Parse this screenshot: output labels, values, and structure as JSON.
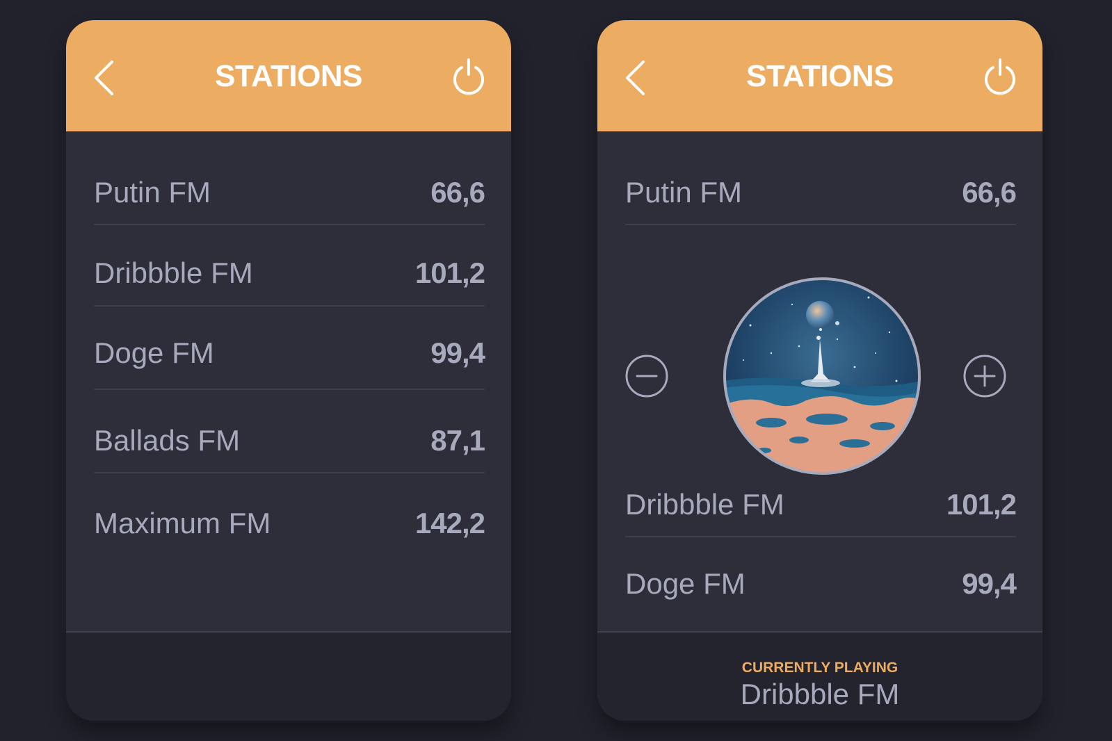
{
  "colors": {
    "background": "#21222c",
    "panel": "#2d2e3a",
    "header_accent": "#ecac62",
    "text": "#a7aabd",
    "divider": "#3e3f4d"
  },
  "left_screen": {
    "header": {
      "title": "STATIONS",
      "back_icon": "chevron-left-icon",
      "power_icon": "power-icon"
    },
    "stations": [
      {
        "name": "Putin FM",
        "frequency": "66,6"
      },
      {
        "name": "Dribbble FM",
        "frequency": "101,2"
      },
      {
        "name": "Doge FM",
        "frequency": "99,4"
      },
      {
        "name": "Ballads FM",
        "frequency": "87,1"
      },
      {
        "name": "Maximum FM",
        "frequency": "142,2"
      }
    ]
  },
  "right_screen": {
    "header": {
      "title": "STATIONS",
      "back_icon": "chevron-left-icon",
      "power_icon": "power-icon"
    },
    "stations": [
      {
        "name": "Putin FM",
        "frequency": "66,6"
      },
      {
        "name": "Dribbble FM",
        "frequency": "101,2"
      },
      {
        "name": "Doge FM",
        "frequency": "99,4"
      }
    ],
    "player": {
      "decrease_icon": "minus-circle-icon",
      "increase_icon": "plus-circle-icon",
      "album_art": "album-art-image"
    },
    "now_playing": {
      "label": "CURRENTLY PLAYING",
      "station": "Dribbble FM"
    }
  }
}
